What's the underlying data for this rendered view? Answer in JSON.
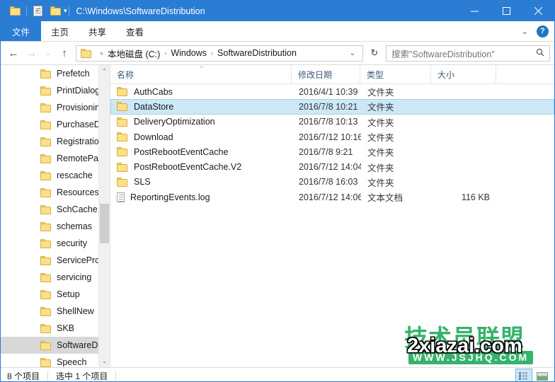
{
  "window": {
    "title": "C:\\Windows\\SoftwareDistribution",
    "quick_access": {
      "folder_icon": "folder-icon",
      "properties_icon": "properties-icon",
      "new_folder_icon": "new-folder-icon",
      "customize_caret": "▾"
    },
    "controls": {
      "minimize": "minimize-icon",
      "maximize": "maximize-icon",
      "close": "close-icon"
    }
  },
  "ribbon": {
    "tabs": [
      {
        "label": "文件",
        "active": true
      },
      {
        "label": "主页",
        "active": false
      },
      {
        "label": "共享",
        "active": false
      },
      {
        "label": "查看",
        "active": false
      }
    ],
    "expand_caret": "⌄",
    "help_label": "?"
  },
  "address": {
    "back": "←",
    "forward": "→",
    "recent_caret": "⌄",
    "up": "↑",
    "breadcrumb_overflow": "«",
    "crumbs": [
      "本地磁盘 (C:)",
      "Windows",
      "SoftwareDistribution"
    ],
    "crumb_separator": "›",
    "dropdown_caret": "⌄",
    "refresh": "↻"
  },
  "search": {
    "placeholder": "搜索\"SoftwareDistribution\"",
    "icon": "search-icon"
  },
  "sidebar": {
    "items": [
      {
        "label": "Prefetch",
        "selected": false
      },
      {
        "label": "PrintDialog",
        "selected": false
      },
      {
        "label": "Provisioning",
        "selected": false
      },
      {
        "label": "PurchaseDi",
        "selected": false
      },
      {
        "label": "Registration",
        "selected": false
      },
      {
        "label": "RemotePac",
        "selected": false
      },
      {
        "label": "rescache",
        "selected": false
      },
      {
        "label": "Resources",
        "selected": false
      },
      {
        "label": "SchCache",
        "selected": false
      },
      {
        "label": "schemas",
        "selected": false
      },
      {
        "label": "security",
        "selected": false
      },
      {
        "label": "ServiceProf",
        "selected": false
      },
      {
        "label": "servicing",
        "selected": false
      },
      {
        "label": "Setup",
        "selected": false
      },
      {
        "label": "ShellNew",
        "selected": false
      },
      {
        "label": "SKB",
        "selected": false
      },
      {
        "label": "SoftwareDi",
        "selected": true
      },
      {
        "label": "Speech",
        "selected": false
      }
    ],
    "scroll_up": "⌃",
    "scroll_down": "⌄"
  },
  "filelist": {
    "columns": [
      {
        "key": "name",
        "label": "名称"
      },
      {
        "key": "date",
        "label": "修改日期"
      },
      {
        "key": "type",
        "label": "类型"
      },
      {
        "key": "size",
        "label": "大小"
      }
    ],
    "sort_indicator": "⌃",
    "rows": [
      {
        "name": "AuthCabs",
        "date": "2016/4/1 10:39",
        "type": "文件夹",
        "size": "",
        "icon": "folder-icon",
        "selected": false
      },
      {
        "name": "DataStore",
        "date": "2016/7/8 10:21",
        "type": "文件夹",
        "size": "",
        "icon": "folder-icon",
        "selected": true
      },
      {
        "name": "DeliveryOptimization",
        "date": "2016/7/8 10:13",
        "type": "文件夹",
        "size": "",
        "icon": "folder-icon",
        "selected": false
      },
      {
        "name": "Download",
        "date": "2016/7/12 10:16",
        "type": "文件夹",
        "size": "",
        "icon": "folder-icon",
        "selected": false
      },
      {
        "name": "PostRebootEventCache",
        "date": "2016/7/8 9:21",
        "type": "文件夹",
        "size": "",
        "icon": "folder-icon",
        "selected": false
      },
      {
        "name": "PostRebootEventCache.V2",
        "date": "2016/7/12 14:04",
        "type": "文件夹",
        "size": "",
        "icon": "folder-icon",
        "selected": false
      },
      {
        "name": "SLS",
        "date": "2016/7/8 16:03",
        "type": "文件夹",
        "size": "",
        "icon": "folder-icon",
        "selected": false
      },
      {
        "name": "ReportingEvents.log",
        "date": "2016/7/12 14:06",
        "type": "文本文档",
        "size": "116 KB",
        "icon": "document-icon",
        "selected": false
      }
    ]
  },
  "watermark": {
    "brand": "技术员联盟",
    "url": "WWW.JSJHQ.COM",
    "overlay": "2xiazai.com",
    "color": "#35b36a"
  },
  "statusbar": {
    "item_count": "8 个项目",
    "selection": "选中 1 个项目",
    "view_details": "details-view",
    "view_large_icons": "large-icons-view"
  },
  "colors": {
    "titlebar": "#2b7cd3",
    "selection": "#cce8f7",
    "selection_border": "#a7cfe8",
    "tree_selection": "#d8d8d8",
    "column_header_text": "#3b5a7a"
  }
}
